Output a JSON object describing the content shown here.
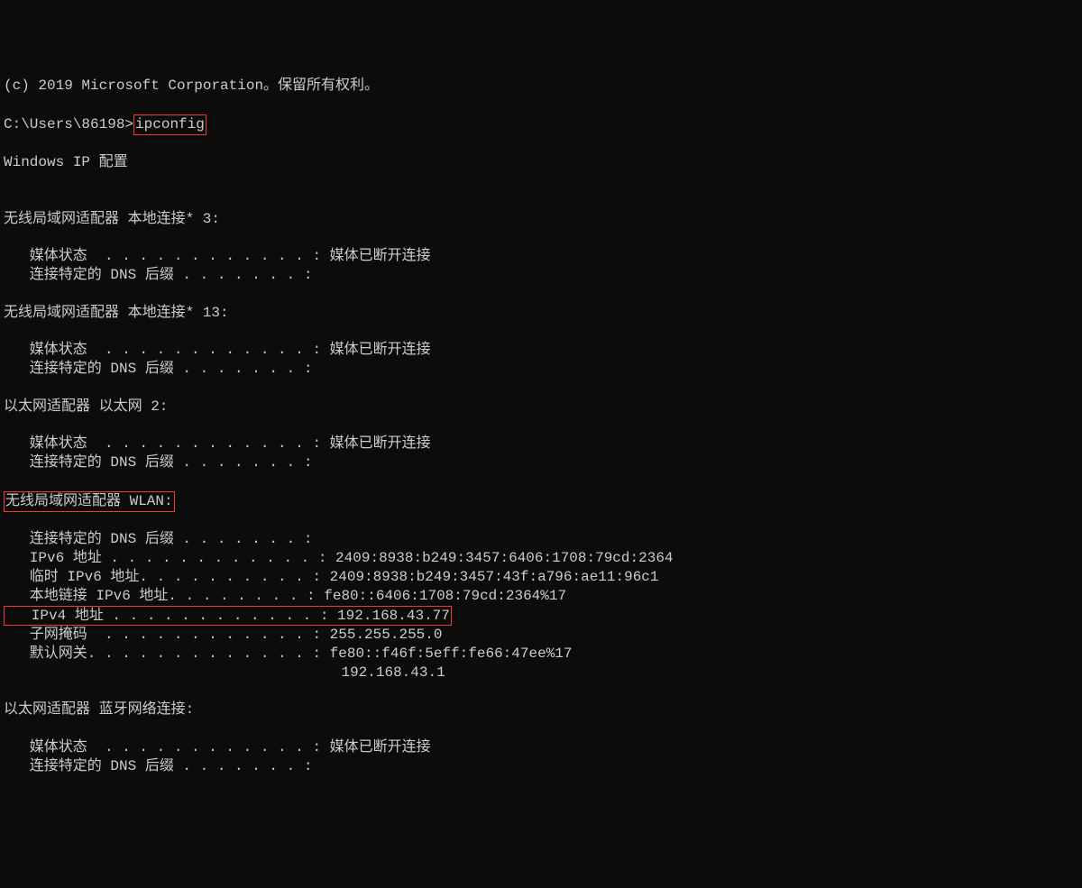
{
  "copyright": "(c) 2019 Microsoft Corporation。保留所有权利。",
  "prompt": {
    "path": "C:\\Users\\86198>",
    "command": "ipconfig"
  },
  "header": "Windows IP 配置",
  "adapters": [
    {
      "title": "无线局域网适配器 本地连接* 3:",
      "lines": [
        {
          "label": "   媒体状态  . . . . . . . . . . . . :",
          "value": " 媒体已断开连接"
        },
        {
          "label": "   连接特定的 DNS 后缀 . . . . . . . :",
          "value": ""
        }
      ]
    },
    {
      "title": "无线局域网适配器 本地连接* 13:",
      "lines": [
        {
          "label": "   媒体状态  . . . . . . . . . . . . :",
          "value": " 媒体已断开连接"
        },
        {
          "label": "   连接特定的 DNS 后缀 . . . . . . . :",
          "value": ""
        }
      ]
    },
    {
      "title": "以太网适配器 以太网 2:",
      "lines": [
        {
          "label": "   媒体状态  . . . . . . . . . . . . :",
          "value": " 媒体已断开连接"
        },
        {
          "label": "   连接特定的 DNS 后缀 . . . . . . . :",
          "value": ""
        }
      ]
    },
    {
      "title": "无线局域网适配器 WLAN:",
      "highlighted": true,
      "lines": [
        {
          "label": "   连接特定的 DNS 后缀 . . . . . . . :",
          "value": ""
        },
        {
          "label": "   IPv6 地址 . . . . . . . . . . . . :",
          "value": " 2409:8938:b249:3457:6406:1708:79cd:2364"
        },
        {
          "label": "   临时 IPv6 地址. . . . . . . . . . :",
          "value": " 2409:8938:b249:3457:43f:a796:ae11:96c1"
        },
        {
          "label": "   本地链接 IPv6 地址. . . . . . . . :",
          "value": " fe80::6406:1708:79cd:2364%17"
        },
        {
          "label": "   IPv4 地址 . . . . . . . . . . . . :",
          "value": " 192.168.43.77",
          "highlighted": true
        },
        {
          "label": "   子网掩码  . . . . . . . . . . . . :",
          "value": " 255.255.255.0"
        },
        {
          "label": "   默认网关. . . . . . . . . . . . . :",
          "value": " fe80::f46f:5eff:fe66:47ee%17"
        },
        {
          "label": "                                      ",
          "value": " 192.168.43.1"
        }
      ]
    },
    {
      "title": "以太网适配器 蓝牙网络连接:",
      "lines": [
        {
          "label": "   媒体状态  . . . . . . . . . . . . :",
          "value": " 媒体已断开连接"
        },
        {
          "label": "   连接特定的 DNS 后缀 . . . . . . . :",
          "value": ""
        }
      ]
    }
  ]
}
